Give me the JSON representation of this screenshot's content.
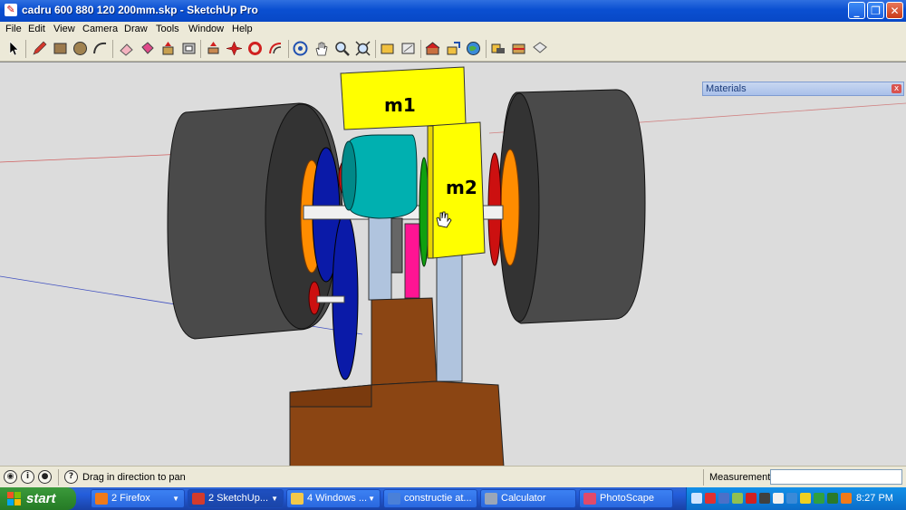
{
  "window": {
    "title": "cadru 600 880 120 200mm.skp - SketchUp Pro",
    "minimize": "_",
    "maximize": "❐",
    "close": "✕"
  },
  "menu": [
    "File",
    "Edit",
    "View",
    "Camera",
    "Draw",
    "Tools",
    "Window",
    "Help"
  ],
  "toolbar": {
    "tools": [
      "select-icon",
      "pencil-icon",
      "rectangle-icon",
      "circle-icon",
      "arc-icon",
      "eraser-icon",
      "paint-bucket-icon",
      "push-pull-icon",
      "offset-icon",
      "move-icon",
      "rotate-icon",
      "follow-me-icon",
      "orbit-icon",
      "pan-icon",
      "zoom-icon",
      "zoom-extents-icon",
      "tape-measure-icon",
      "protractor-icon",
      "warehouse-icon",
      "component-icon",
      "globe-icon",
      "shadow-icon",
      "section-icon",
      "style-icon"
    ]
  },
  "model": {
    "labels": {
      "m1": "m1",
      "m2": "m2"
    },
    "colors": {
      "tire": "#3c3c3c",
      "rim_orange": "#ff8c00",
      "motor_box": "#ffff00",
      "cylinder": "#00b0b0",
      "gear_blue": "#0a1aa8",
      "gear_red": "#cc1010",
      "gear_green": "#10a010",
      "pink_bar": "#ff1493",
      "base_brown": "#8b4513",
      "axle": "#f0f0f0",
      "strut": "#b0c4de"
    }
  },
  "materials_panel": {
    "title": "Materials",
    "close": "x"
  },
  "status": {
    "hint": "Drag in direction to pan",
    "measurements_label": "Measurements",
    "measurements_value": ""
  },
  "taskbar": {
    "start": "start",
    "tasks": [
      {
        "label": "2 Firefox",
        "icon_color": "#f07a1a",
        "active": false
      },
      {
        "label": "2 SketchUp...",
        "icon_color": "#d33b2c",
        "active": true
      },
      {
        "label": "4 Windows ...",
        "icon_color": "#f3c84a",
        "active": false
      },
      {
        "label": "constructie at...",
        "icon_color": "#4a80d8",
        "active": false
      },
      {
        "label": "Calculator",
        "icon_color": "#9aa6b8",
        "active": false
      },
      {
        "label": "PhotoScape",
        "icon_color": "#e04a6a",
        "active": false
      }
    ],
    "clock": "8:27 PM"
  }
}
